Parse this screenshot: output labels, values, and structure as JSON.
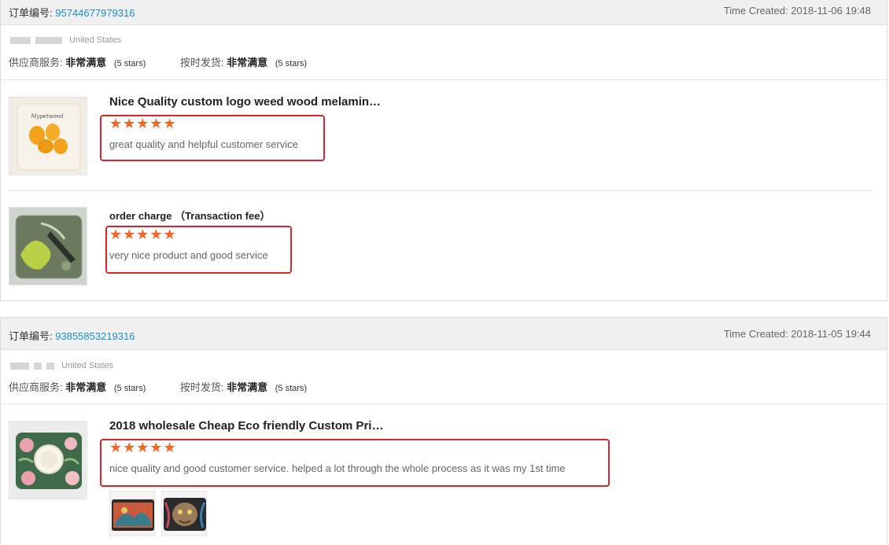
{
  "orders": [
    {
      "order_label": "订单编号:",
      "order_number": "95744677979316",
      "time_created": "Time Created: 2018-11-06 19:48",
      "buyer_country": "United States",
      "supplier_service_label": "供应商服务:",
      "supplier_service_value": "非常满意",
      "supplier_service_stars": "(5 stars)",
      "shipping_label": "按时发货:",
      "shipping_value": "非常满意",
      "shipping_stars": "(5 stars)",
      "items": [
        {
          "title": "Nice Quality custom logo weed wood melamin…",
          "stars": "★★★★★",
          "rating": 5,
          "comment": "great quality and helpful customer service",
          "thumb_text": "Mypetweed"
        },
        {
          "title": "order charge （Transaction fee）",
          "stars": "★★★★★",
          "rating": 5,
          "comment": "very nice product and good service"
        }
      ]
    },
    {
      "order_label": "订单编号:",
      "order_number": "93855853219316",
      "time_created": "Time Created: 2018-11-05 19:44",
      "buyer_country": "United States",
      "supplier_service_label": "供应商服务:",
      "supplier_service_value": "非常满意",
      "supplier_service_stars": "(5 stars)",
      "shipping_label": "按时发货:",
      "shipping_value": "非常满意",
      "shipping_stars": "(5 stars)",
      "items": [
        {
          "title": "2018 wholesale Cheap Eco friendly Custom Pri…",
          "stars": "★★★★★",
          "rating": 5,
          "comment": "nice quality and good customer service.  helped a lot through the whole process as it was my 1st time"
        }
      ]
    }
  ],
  "colors": {
    "order_number": "#1a8fd0",
    "stars": "#f26522",
    "highlight_box": "#d9232d"
  }
}
